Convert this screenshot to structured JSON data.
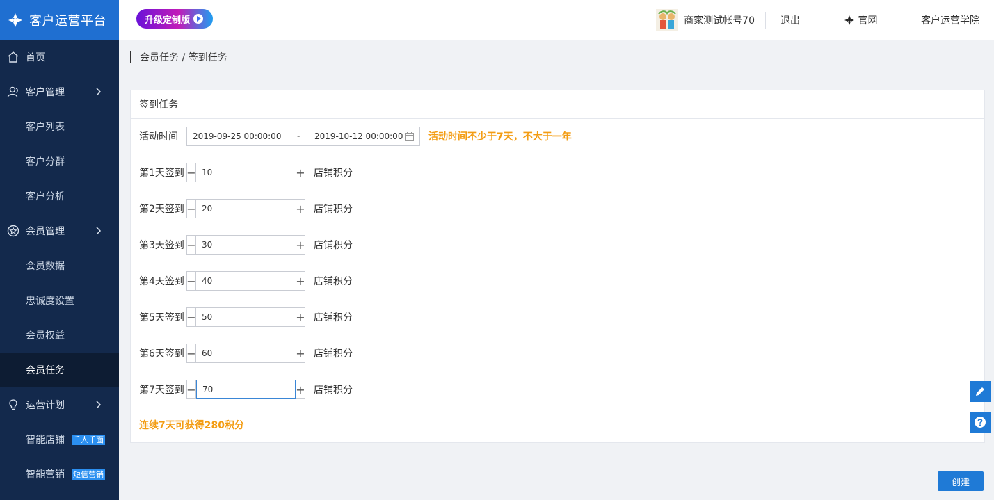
{
  "app": {
    "title": "客户运营平台",
    "accent": "#1f6fd1"
  },
  "sidebar": {
    "items": [
      {
        "label": "首页",
        "icon": "home-icon",
        "level": "top"
      },
      {
        "label": "客户管理",
        "icon": "user-group-icon",
        "level": "top",
        "expandable": true
      },
      {
        "label": "客户列表",
        "level": "sub"
      },
      {
        "label": "客户分群",
        "level": "sub"
      },
      {
        "label": "客户分析",
        "level": "sub"
      },
      {
        "label": "会员管理",
        "icon": "star-circle-icon",
        "level": "top",
        "expandable": true
      },
      {
        "label": "会员数据",
        "level": "sub"
      },
      {
        "label": "忠诚度设置",
        "level": "sub"
      },
      {
        "label": "会员权益",
        "level": "sub"
      },
      {
        "label": "会员任务",
        "level": "sub",
        "active": true
      },
      {
        "label": "运营计划",
        "icon": "lightbulb-icon",
        "level": "top",
        "expandable": true
      },
      {
        "label": "智能店铺",
        "level": "sub",
        "tag": "千人千面"
      },
      {
        "label": "智能营销",
        "level": "sub",
        "tag": "短信营销"
      }
    ]
  },
  "header": {
    "upgrade_label": "升级定制版",
    "account_name": "商家测试帐号70",
    "logout_label": "退出",
    "official_label": "官网",
    "academy_label": "客户运营学院"
  },
  "breadcrumb": "会员任务 / 签到任务",
  "panel": {
    "title": "签到任务",
    "activity_label": "活动时间",
    "start_date": "2019-09-25 00:00:00",
    "date_separator": "-",
    "end_date": "2019-10-12 00:00:00",
    "date_hint": "活动时间不少于7天，不大于一年",
    "unit_label": "店铺积分",
    "days": [
      {
        "label": "第1天签到",
        "value": "10"
      },
      {
        "label": "第2天签到",
        "value": "20"
      },
      {
        "label": "第3天签到",
        "value": "30"
      },
      {
        "label": "第4天签到",
        "value": "40"
      },
      {
        "label": "第5天签到",
        "value": "50"
      },
      {
        "label": "第6天签到",
        "value": "60"
      },
      {
        "label": "第7天签到",
        "value": "70",
        "focused": true
      }
    ],
    "summary": "连续7天可获得280积分"
  },
  "actions": {
    "create_label": "创建"
  },
  "colors": {
    "hint": "#f39c12",
    "primary_button": "#1f7ad6",
    "sidebar_bg": "#13294c"
  }
}
